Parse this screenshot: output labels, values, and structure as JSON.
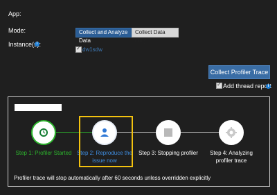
{
  "form": {
    "app_label": "App:",
    "mode_label": "Mode:",
    "mode_options": [
      "Collect and Analyze Data",
      "Collect Data Only"
    ],
    "instances_label": "Instance(s):",
    "instance_name": "dw1sdw"
  },
  "actions": {
    "collect_button": "Collect Profiler Trace",
    "thread_report_label": "Add thread report"
  },
  "steps": [
    {
      "label": "Step 1: Profiler Started"
    },
    {
      "label": "Step 2: Reproduce the issue now"
    },
    {
      "label": "Step 3: Stopping profiler"
    },
    {
      "label": "Step 4: Analyzing profiler trace"
    }
  ],
  "footer": "Profiler trace will stop automatically after 60 seconds unless overridden explicitly",
  "colors": {
    "accent": "#2b5d95",
    "success": "#2db52d",
    "active_step": "#3f8de0",
    "highlight": "#f3c20f"
  }
}
